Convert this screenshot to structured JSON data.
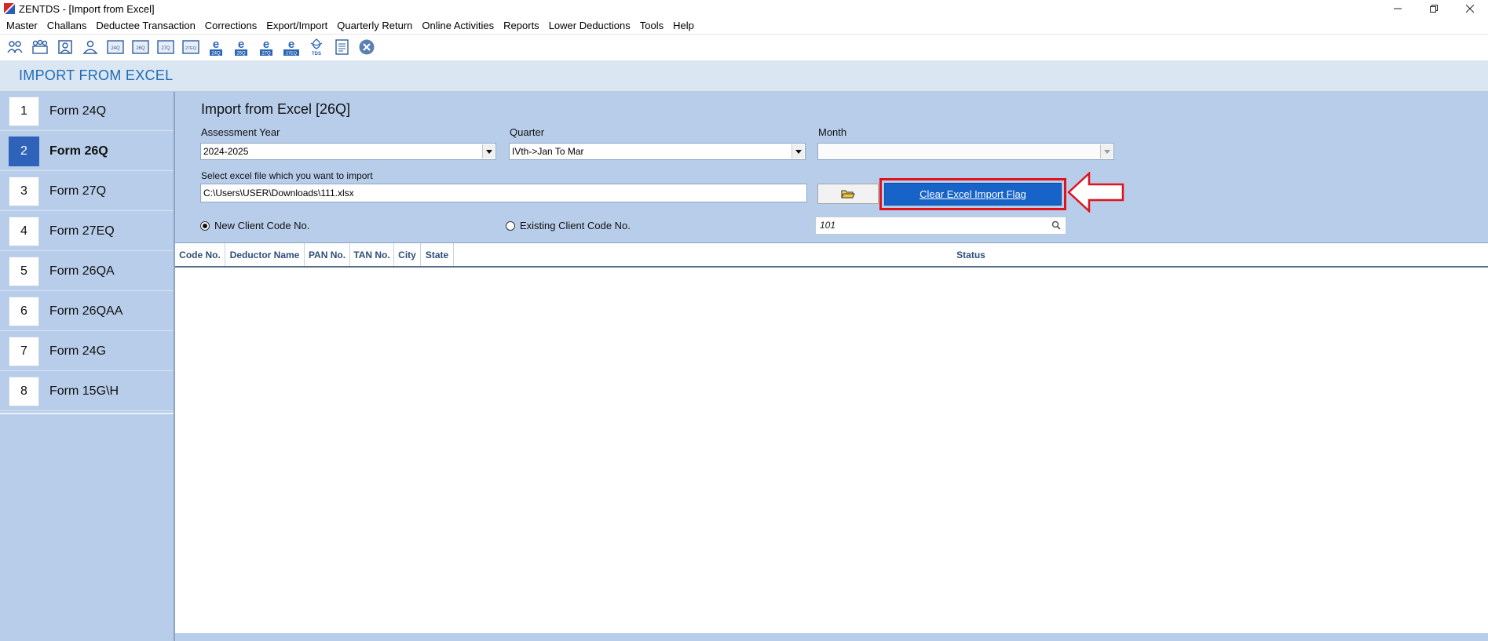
{
  "window": {
    "title": "ZENTDS - [Import from Excel]",
    "controls": [
      "minimize",
      "restore",
      "close"
    ]
  },
  "menu": {
    "items": [
      "Master",
      "Challans",
      "Deductee Transaction",
      "Corrections",
      "Export/Import",
      "Quarterly Return",
      "Online Activities",
      "Reports",
      "Lower Deductions",
      "Tools",
      "Help"
    ]
  },
  "toolbar": {
    "icons": [
      "users-icon",
      "group-icon",
      "deductor-icon",
      "person-icon",
      "form-24q-icon",
      "form-26q-icon",
      "form-27q-icon",
      "form-27eq-icon",
      "e-24q-icon",
      "e-26q-icon",
      "e-27q-icon",
      "e-27eq-icon",
      "tds-icon",
      "report-icon",
      "close-circle-icon"
    ],
    "labels": {
      "e24": "24Q",
      "e26": "26Q",
      "e27": "27Q",
      "e27e": "27EQ",
      "tds": "TDS",
      "f24": "24Q",
      "f26": "26Q",
      "f27": "27Q",
      "f27e": "27EQ"
    }
  },
  "header": {
    "title": "IMPORT FROM EXCEL"
  },
  "sidebar": {
    "items": [
      {
        "num": "1",
        "label": "Form 24Q"
      },
      {
        "num": "2",
        "label": "Form 26Q"
      },
      {
        "num": "3",
        "label": "Form 27Q"
      },
      {
        "num": "4",
        "label": "Form 27EQ"
      },
      {
        "num": "5",
        "label": "Form 26QA"
      },
      {
        "num": "6",
        "label": "Form 26QAA"
      },
      {
        "num": "7",
        "label": "Form 24G"
      },
      {
        "num": "8",
        "label": "Form 15G\\H"
      }
    ],
    "active_index": 1
  },
  "form": {
    "title": "Import from Excel [26Q]",
    "assessment_year_label": "Assessment Year",
    "assessment_year_value": "2024-2025",
    "quarter_label": "Quarter",
    "quarter_value": "IVth->Jan To Mar",
    "month_label": "Month",
    "month_value": "",
    "file_label": "Select excel file which you want to import",
    "file_path": "C:\\Users\\USER\\Downloads\\111.xlsx",
    "clear_flag_button": "Clear Excel Import Flag",
    "new_client_radio": "New Client Code No.",
    "existing_client_radio": "Existing Client Code No.",
    "selected_radio": "new",
    "client_code_value": "101"
  },
  "table": {
    "columns": [
      "Code No.",
      "Deductor Name",
      "PAN No.",
      "TAN No.",
      "City",
      "State",
      "Status"
    ],
    "rows": []
  },
  "colors": {
    "accent": "#1763c7",
    "sidebar_bg": "#b7cde9",
    "highlight": "#e1121c",
    "header_text": "#1f6cb3"
  }
}
